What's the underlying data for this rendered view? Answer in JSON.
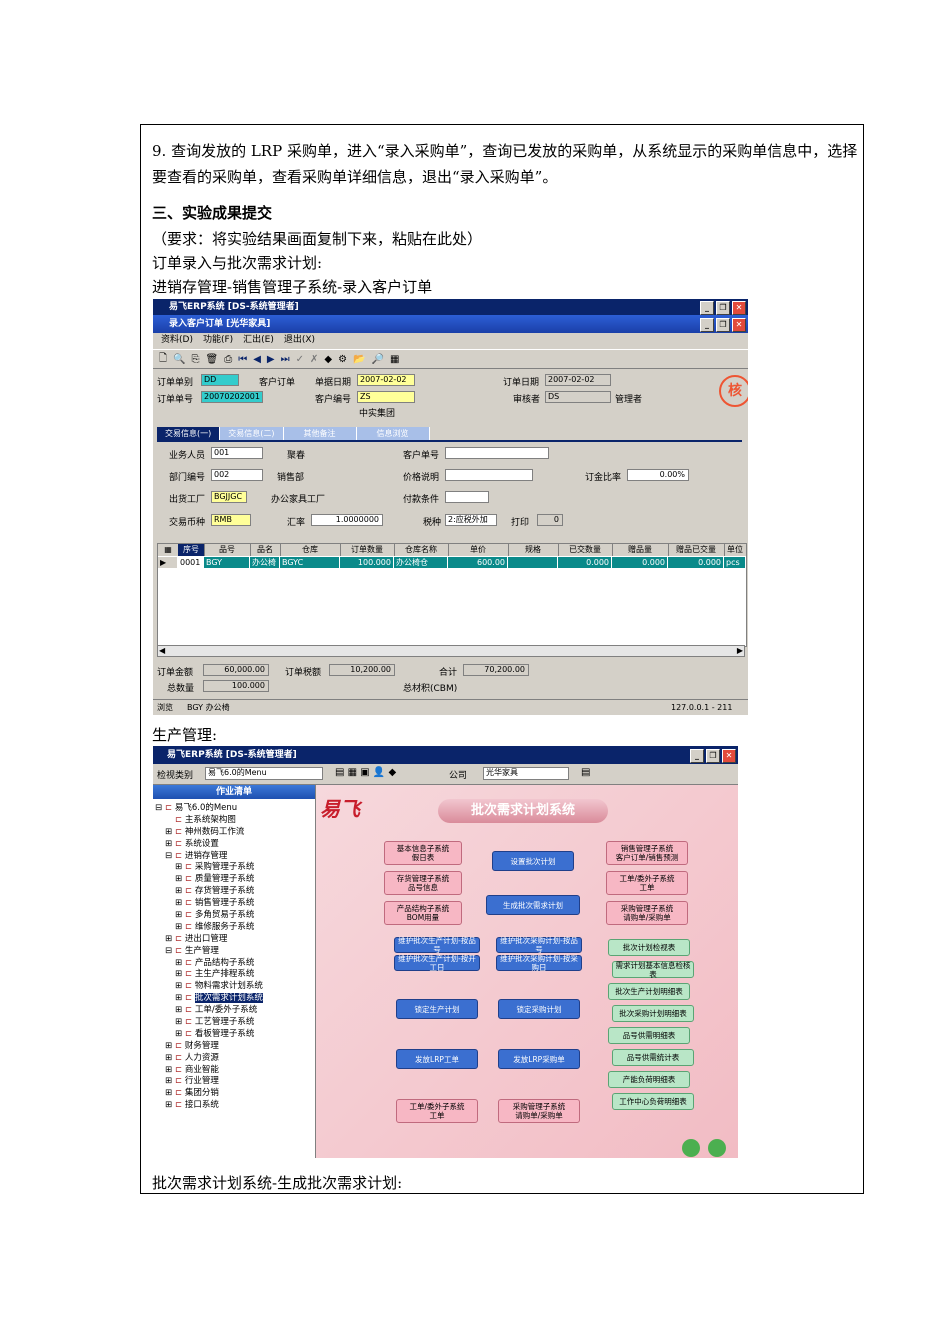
{
  "doc": {
    "step9": "9. 查询发放的 LRP 采购单，进入“录入采购单”，查询已发放的采购单，从系统显示的采购单信息中，选择要查看的采购单，查看采购单详细信息，退出“录入采购单”。",
    "section3": "三、实验成果提交",
    "requirement": "（要求：将实验结果画面复制下来，粘贴在此处）",
    "caption1": "订单录入与批次需求计划:",
    "caption2": "进销存管理-销售管理子系统-录入客户订单",
    "caption3": "生产管理:",
    "caption4": "批次需求计划系统-生成批次需求计划:"
  },
  "order_window": {
    "app_title": "易飞ERP系统 [DS-系统管理者]",
    "form_title": "录入客户订单 [光华家具]",
    "menus": [
      "资料(D)",
      "功能(F)",
      "汇出(E)",
      "退出(X)"
    ],
    "labels": {
      "order_type": "订单单别",
      "order_type_value": "DD",
      "order_type_name": "客户订单",
      "doc_date": "单据日期",
      "doc_date_value": "2007-02-02",
      "order_date": "订单日期",
      "order_date_value": "2007-02-02",
      "order_no": "订单单号",
      "order_no_value": "20070202001",
      "customer_no": "客户编号",
      "customer_no_value": "ZS",
      "customer_name": "中实集团",
      "reviewer": "审核者",
      "reviewer_value": "DS",
      "reviewer_name": "管理者",
      "stamp": "核"
    },
    "tabs": [
      "交易信息(一)",
      "交易信息(二)",
      "其他备注",
      "信息浏览"
    ],
    "panel": {
      "salesperson": "业务人员",
      "salesperson_value": "001",
      "salesperson_name": "聚春",
      "customer_order_no": "客户单号",
      "dept_no": "部门编号",
      "dept_no_value": "002",
      "dept_name": "销售部",
      "price_note": "价格说明",
      "deposit_ratio": "订金比率",
      "deposit_ratio_value": "0.00%",
      "factory": "出货工厂",
      "factory_value": "BGJJGC",
      "factory_name": "办公家具工厂",
      "payment_terms": "付款条件",
      "currency": "交易币种",
      "currency_value": "RMB",
      "rate": "汇率",
      "rate_value": "1.0000000",
      "tax_type": "税种",
      "tax_type_value": "2:应税外加",
      "print": "打印",
      "print_value": "0"
    },
    "grid_headers": [
      "序号",
      "品号",
      "品名",
      "仓库",
      "订单数量",
      "仓库名称",
      "单价",
      "规格",
      "已交数量",
      "赠品量",
      "赠品已交量",
      "单位"
    ],
    "grid_row": [
      "0001",
      "BGY",
      "办公椅",
      "BGYC",
      "100.000",
      "办公椅仓",
      "600.00",
      "",
      "0.000",
      "0.000",
      "0.000",
      "pcs"
    ],
    "totals": {
      "order_amount": "订单金额",
      "order_amount_value": "60,000.00",
      "order_tax": "订单税额",
      "order_tax_value": "10,200.00",
      "total": "合计",
      "total_value": "70,200.00",
      "total_qty": "总数量",
      "total_qty_value": "100.000",
      "total_volume": "总材积(CBM)"
    },
    "status": {
      "mode": "浏览",
      "item": "BGY 办公椅",
      "ip": "127.0.0.1 - 211"
    }
  },
  "prod_window": {
    "app_title": "易飞ERP系统 [DS-系统管理者]",
    "view_type": "检视类别",
    "view_type_value": "易飞6.0的Menu",
    "company": "公司",
    "company_value": "光华家具",
    "tree_head": "作业清单",
    "tree": [
      {
        "t": "易飞6.0的Menu",
        "l": 0,
        "sign": "⊟"
      },
      {
        "t": "主系统架构图",
        "l": 1,
        "sign": ""
      },
      {
        "t": "神州数码工作流",
        "l": 1,
        "sign": "⊞"
      },
      {
        "t": "系统设置",
        "l": 1,
        "sign": "⊞"
      },
      {
        "t": "进销存管理",
        "l": 1,
        "sign": "⊟"
      },
      {
        "t": "采购管理子系统",
        "l": 2,
        "sign": "⊞"
      },
      {
        "t": "质量管理子系统",
        "l": 2,
        "sign": "⊞"
      },
      {
        "t": "存货管理子系统",
        "l": 2,
        "sign": "⊞"
      },
      {
        "t": "销售管理子系统",
        "l": 2,
        "sign": "⊞"
      },
      {
        "t": "多角贸易子系统",
        "l": 2,
        "sign": "⊞"
      },
      {
        "t": "维修服务子系统",
        "l": 2,
        "sign": "⊞"
      },
      {
        "t": "进出口管理",
        "l": 1,
        "sign": "⊞"
      },
      {
        "t": "生产管理",
        "l": 1,
        "sign": "⊟"
      },
      {
        "t": "产品结构子系统",
        "l": 2,
        "sign": "⊞"
      },
      {
        "t": "主生产排程系统",
        "l": 2,
        "sign": "⊞"
      },
      {
        "t": "物料需求计划系统",
        "l": 2,
        "sign": "⊞"
      },
      {
        "t": "批次需求计划系统",
        "l": 2,
        "sign": "⊞",
        "sel": true
      },
      {
        "t": "工单/委外子系统",
        "l": 2,
        "sign": "⊞"
      },
      {
        "t": "工艺管理子系统",
        "l": 2,
        "sign": "⊞"
      },
      {
        "t": "看板管理子系统",
        "l": 2,
        "sign": "⊞"
      },
      {
        "t": "财务管理",
        "l": 1,
        "sign": "⊞"
      },
      {
        "t": "人力资源",
        "l": 1,
        "sign": "⊞"
      },
      {
        "t": "商业智能",
        "l": 1,
        "sign": "⊞"
      },
      {
        "t": "行业管理",
        "l": 1,
        "sign": "⊞"
      },
      {
        "t": "集团分销",
        "l": 1,
        "sign": "⊞"
      },
      {
        "t": "接口系统",
        "l": 1,
        "sign": "⊞"
      }
    ],
    "logo": "易飞",
    "flow_title": "批次需求计划系统",
    "flow": {
      "src1": "基本信息子系统\n假日表",
      "src2": "存货管理子系统\n品号信息",
      "src3": "产品结构子系统\nBOM用量",
      "src4": "销售管理子系统\n客户订单/销售预测",
      "src5": "工单/委外子系统\n工单",
      "src6": "采购管理子系统\n请购单/采购单",
      "set": "设置批次计划",
      "gen": "生成批次需求计划",
      "m1": "维护批次生产计划-按品号",
      "m2": "维护批次采购计划-按品号",
      "m3": "维护批次生产计划-按开工日",
      "m4": "维护批次采购计划-按采购日",
      "lock1": "锁定生产计划",
      "lock2": "锁定采购计划",
      "rel1": "发放LRP工单",
      "rel2": "发放LRP采购单",
      "dst1": "工单/委外子系统\n工单",
      "dst2": "采购管理子系统\n请购单/采购单",
      "reports": [
        "批次计划检视表",
        "需求计划基本信息检核表",
        "批次生产计划明细表",
        "批次采购计划明细表",
        "品号供需明细表",
        "品号供需统计表",
        "产能负荷明细表",
        "工作中心负荷明细表"
      ]
    }
  }
}
